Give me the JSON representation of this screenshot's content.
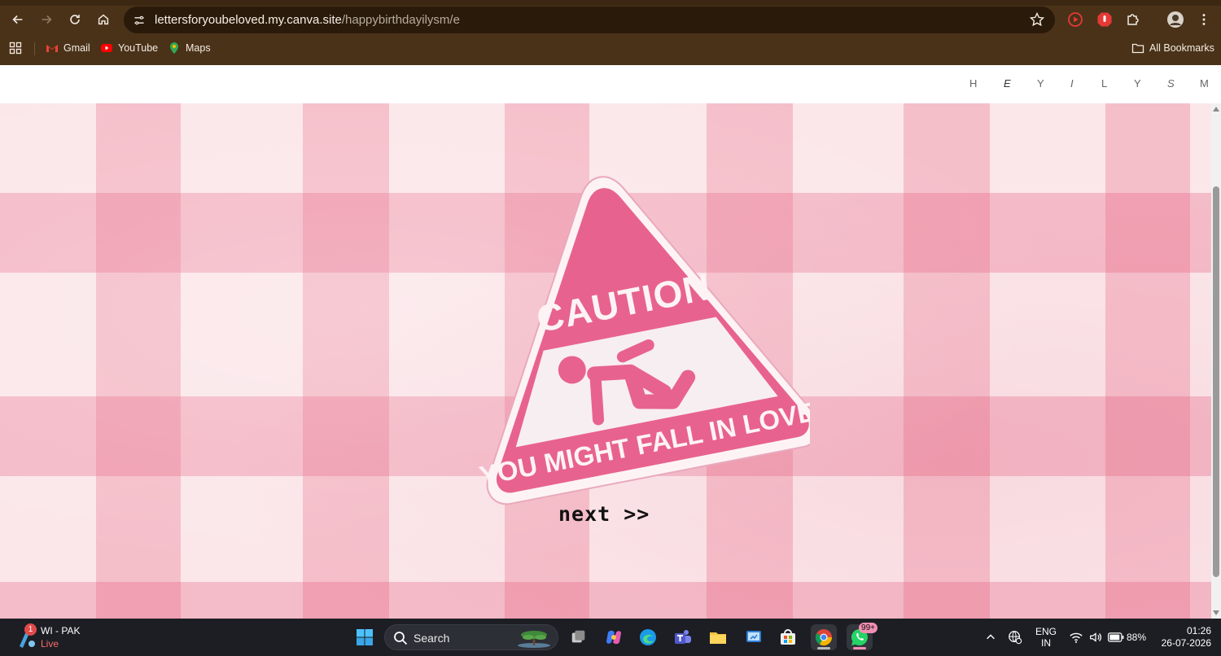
{
  "browser": {
    "url_host": "lettersforyoubeloved.my.canva.site",
    "url_path": "/happybirthdayilysm/e",
    "bookmarks": [
      {
        "label": "Gmail"
      },
      {
        "label": "YouTube"
      },
      {
        "label": "Maps"
      }
    ],
    "all_bookmarks_label": "All Bookmarks"
  },
  "site": {
    "nav_letters": [
      "H",
      "E",
      "Y",
      "I",
      "L",
      "Y",
      "S",
      "M"
    ],
    "sign": {
      "top_text": "CAUTION",
      "bottom_text": "YOU MIGHT FALL IN LOVE."
    },
    "next_label": "next >>",
    "colors": {
      "accent_pink": "#e8628f",
      "background_pink": "#fbe7ea"
    }
  },
  "taskbar": {
    "weather": {
      "badge": "1",
      "title": "WI - PAK",
      "status": "Live"
    },
    "search_label": "Search",
    "whatsapp_badge": "99+",
    "language": {
      "line1": "ENG",
      "line2": "IN"
    },
    "battery": "88%",
    "time": "01:26",
    "date": "26-07-2026"
  }
}
